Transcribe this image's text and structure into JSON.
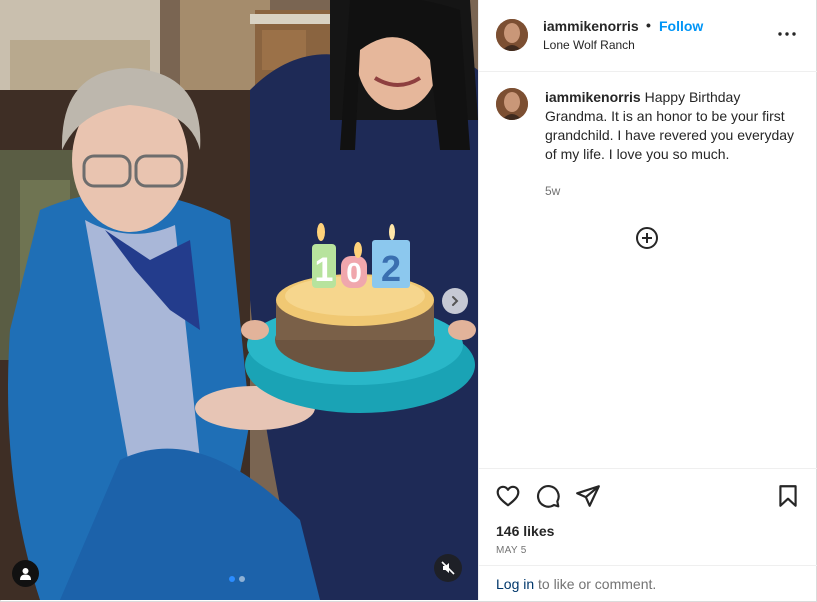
{
  "post": {
    "username": "iammikenorris",
    "separator": "•",
    "follow_label": "Follow",
    "location": "Lone Wolf Ranch"
  },
  "caption": {
    "username": "iammikenorris",
    "text": "Happy Birthday Grandma. It is an honor to be your first grandchild. I have revered you everyday of my life. I love you so much.",
    "time_ago": "5w"
  },
  "media": {
    "candle_digits": [
      "1",
      "0",
      "2"
    ],
    "carousel_total": 2,
    "carousel_active_index": 0
  },
  "stats": {
    "likes": "146 likes",
    "date": "MAY 5"
  },
  "comment_bar": {
    "login_link": "Log in",
    "login_rest": "to like or comment."
  },
  "icons": {
    "next": "chevron-right-icon",
    "tagged_user": "user-icon",
    "mute": "speaker-muted-icon",
    "more": "more-horizontal-icon",
    "load_more": "plus-circle-icon",
    "like": "heart-icon",
    "comment": "comment-icon",
    "share": "paper-plane-icon",
    "save": "bookmark-icon"
  },
  "colors": {
    "follow": "#0095f6",
    "link": "#00376b",
    "muted_text": "#737373",
    "active_dot": "#2b8cff"
  }
}
